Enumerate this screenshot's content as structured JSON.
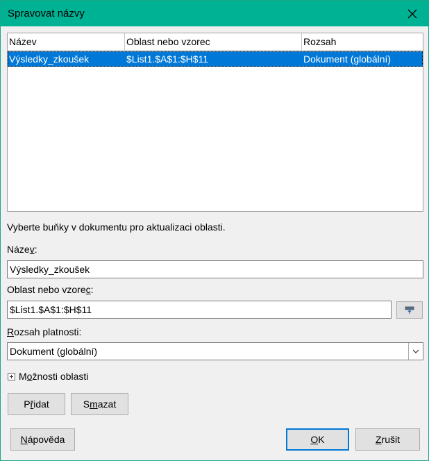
{
  "window": {
    "title": "Spravovat názvy"
  },
  "table": {
    "columns": [
      "Název",
      "Oblast nebo vzorec",
      "Rozsah"
    ],
    "rows": [
      {
        "name": "Výsledky_zkoušek",
        "range": "$List1.$A$1:$H$11",
        "scope": "Dokument (globální)"
      }
    ]
  },
  "hint": "Vyberte buňky v dokumentu pro aktualizaci oblasti.",
  "name_field": {
    "label_a": "Náze",
    "label_u": "v",
    "label_b": ":",
    "value": "Výsledky_zkoušek"
  },
  "range_field": {
    "label_a": "Oblast nebo vzore",
    "label_u": "c",
    "label_b": ":",
    "value": "$List1.$A$1:$H$11"
  },
  "scope_field": {
    "label_u": "R",
    "label_b": "ozsah platnosti:",
    "value": "Dokument (globální)"
  },
  "options": {
    "label_a": "M",
    "label_u": "o",
    "label_b": "žnosti oblasti"
  },
  "buttons": {
    "add": {
      "a": "P",
      "u": "ř",
      "b": "idat"
    },
    "delete": {
      "a": "S",
      "u": "m",
      "b": "azat"
    },
    "help": {
      "a": "",
      "u": "N",
      "b": "ápověda"
    },
    "ok": {
      "a": "",
      "u": "O",
      "b": "K"
    },
    "cancel": {
      "a": "",
      "u": "Z",
      "b": "rušit"
    }
  },
  "colors": {
    "titlebar": "#00b294",
    "selection": "#0078d7"
  },
  "icons": {
    "close": "close-icon",
    "shrink": "shrink-icon",
    "dropdown": "chevron-down-icon",
    "expand": "plus-box-icon"
  }
}
